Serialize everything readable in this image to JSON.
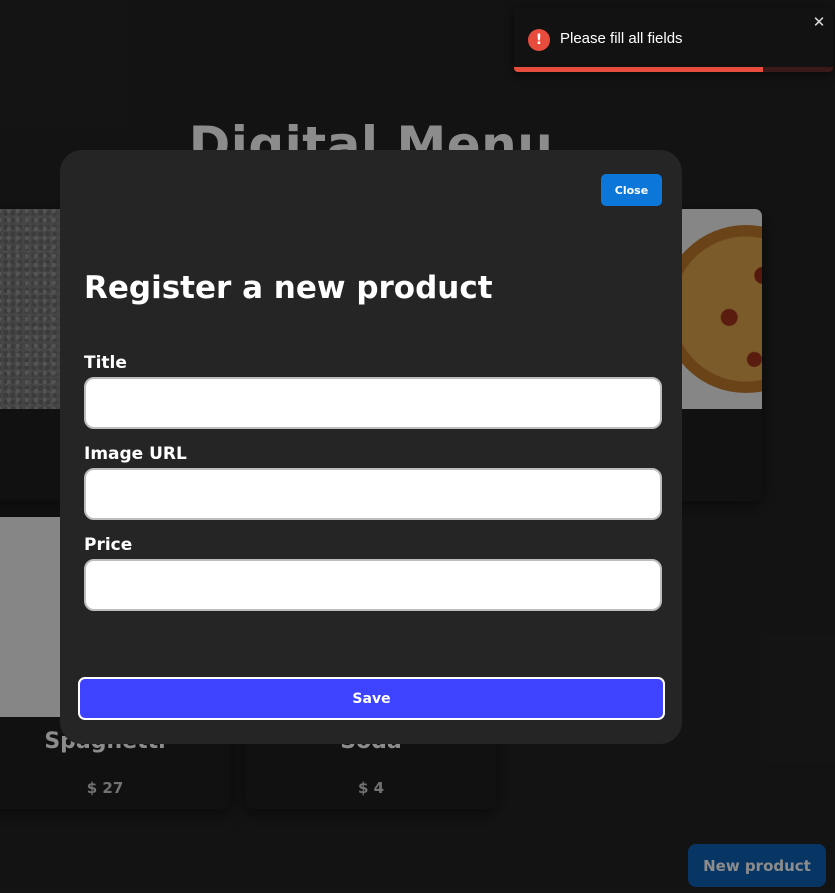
{
  "page": {
    "title": "Digital Menu"
  },
  "products": [
    {
      "name": "",
      "price": "",
      "image": "stone-plate"
    },
    {
      "name": "",
      "price": "",
      "image": "pizza"
    },
    {
      "name": "Spaghetti",
      "price": "$ 27",
      "image": "spaghetti"
    },
    {
      "name": "Soda",
      "price": "$ 4",
      "image": "soda"
    }
  ],
  "modal": {
    "close_label": "Close",
    "title": "Register a new product",
    "fields": {
      "title": {
        "label": "Title",
        "value": "",
        "placeholder": ""
      },
      "image_url": {
        "label": "Image URL",
        "value": "",
        "placeholder": ""
      },
      "price": {
        "label": "Price",
        "value": "",
        "placeholder": ""
      }
    },
    "save_label": "Save"
  },
  "new_product_label": "New product",
  "toast": {
    "message": "Please fill all fields",
    "close_icon": "close-icon",
    "status_icon": "error-icon",
    "progress": 0.78,
    "color": "#e74c3c"
  },
  "colors": {
    "accent": "#0d77d9",
    "save": "#3d43ff",
    "error": "#e74c3c"
  }
}
